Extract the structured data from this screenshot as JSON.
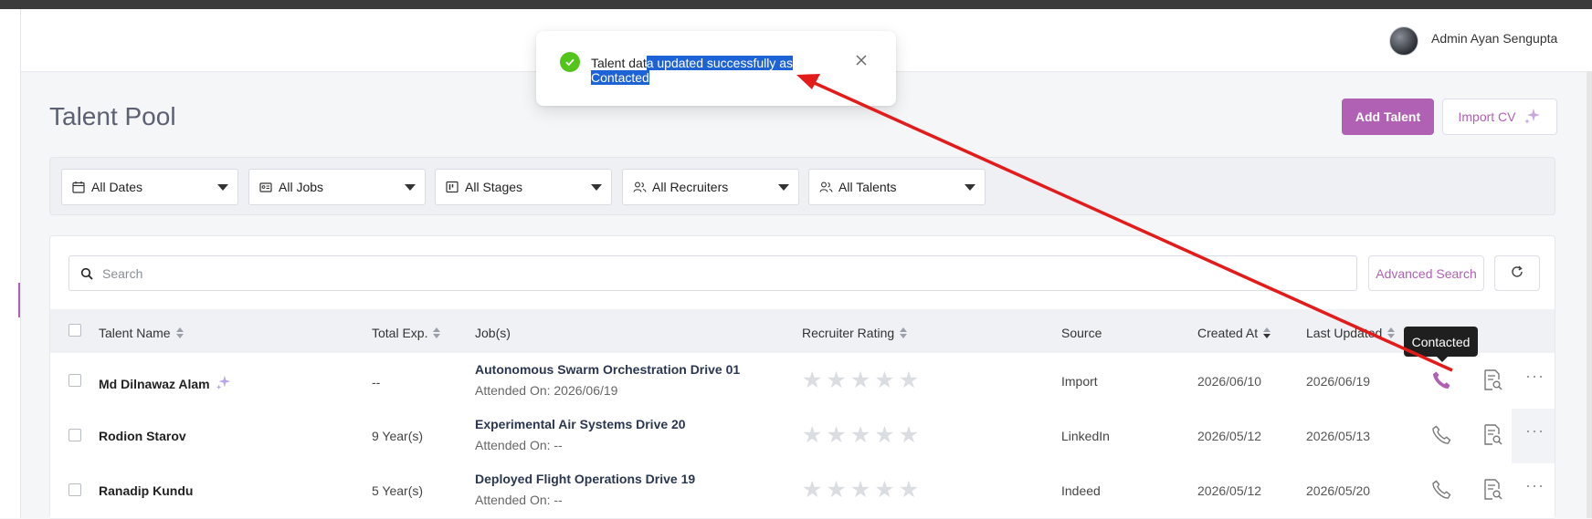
{
  "header": {
    "user_name": "Admin Ayan Sengupta"
  },
  "page": {
    "title": "Talent Pool",
    "add_button": "Add Talent",
    "import_button": "Import CV"
  },
  "filters": [
    {
      "label": "All Dates",
      "icon": "calendar-icon"
    },
    {
      "label": "All Jobs",
      "icon": "id-card-icon"
    },
    {
      "label": "All Stages",
      "icon": "kanban-icon"
    },
    {
      "label": "All Recruiters",
      "icon": "users-icon"
    },
    {
      "label": "All Talents",
      "icon": "users-icon"
    }
  ],
  "search": {
    "placeholder": "Search",
    "advanced_label": "Advanced Search"
  },
  "table": {
    "columns": [
      "Talent Name",
      "Total Exp.",
      "Job(s)",
      "Recruiter Rating",
      "Source",
      "Created At",
      "Last Updated"
    ],
    "rows": [
      {
        "name": "Md Dilnawaz Alam",
        "exp": "--",
        "job": "Autonomous Swarm Orchestration Drive 01",
        "attended": "Attended On: 2026/06/19",
        "rating": 0,
        "source": "Import",
        "created": "2026/06/10",
        "updated": "2026/06/19",
        "ai_badge": true,
        "contacted": true
      },
      {
        "name": "Rodion Starov",
        "exp": "9 Year(s)",
        "job": "Experimental Air Systems Drive 20",
        "attended": "Attended On: --",
        "rating": 0,
        "source": "LinkedIn",
        "created": "2026/05/12",
        "updated": "2026/05/13",
        "ai_badge": false,
        "contacted": false
      },
      {
        "name": "Ranadip Kundu",
        "exp": "5 Year(s)",
        "job": "Deployed Flight Operations Drive 19",
        "attended": "Attended On: --",
        "rating": 0,
        "source": "Indeed",
        "created": "2026/05/12",
        "updated": "2026/05/20",
        "ai_badge": false,
        "contacted": false
      }
    ]
  },
  "tooltip": {
    "text": "Contacted"
  },
  "toast": {
    "text_plain": "Talent dat",
    "text_selected": "a updated successfully as Contacted",
    "status": "success"
  },
  "colors": {
    "accent": "#b061b4",
    "success": "#52c41a",
    "annotation_arrow": "#e31b1b",
    "selection": "#1e63d6"
  }
}
